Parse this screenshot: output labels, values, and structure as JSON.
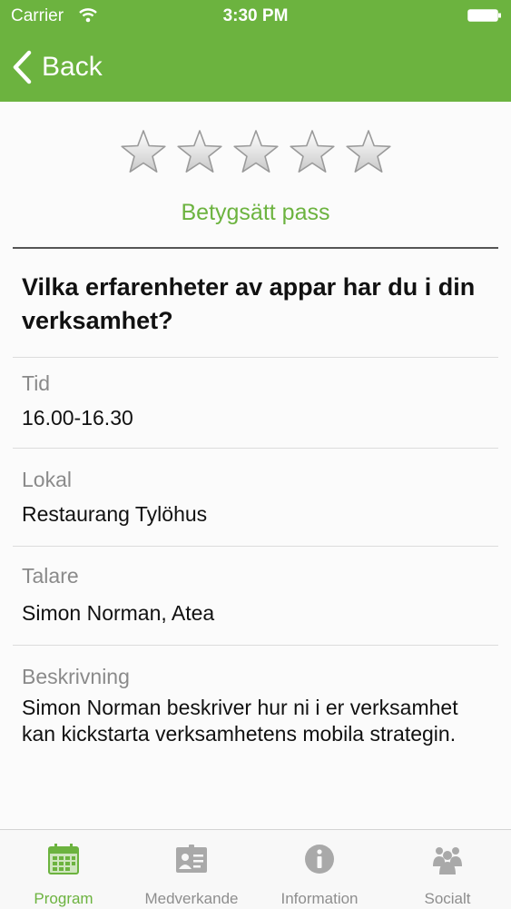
{
  "status_bar": {
    "carrier": "Carrier",
    "time": "3:30 PM"
  },
  "nav": {
    "back_label": "Back"
  },
  "rating": {
    "star_count": 5,
    "label": "Betygsätt pass"
  },
  "session": {
    "title": "Vilka erfarenheter av appar har du i din verksamhet?",
    "fields": [
      {
        "label": "Tid",
        "value": "16.00-16.30"
      },
      {
        "label": "Lokal",
        "value": "Restaurang Tylöhus"
      },
      {
        "label": "Talare",
        "value": "Simon Norman, Atea"
      },
      {
        "label": "Beskrivning",
        "value": "Simon Norman beskriver hur ni i er verksamhet kan kickstarta verksamhetens mobila strategin."
      }
    ]
  },
  "tabs": [
    {
      "label": "Program",
      "icon": "calendar-icon",
      "active": true
    },
    {
      "label": "Medverkande",
      "icon": "id-card-icon",
      "active": false
    },
    {
      "label": "Information",
      "icon": "info-icon",
      "active": false
    },
    {
      "label": "Socialt",
      "icon": "people-icon",
      "active": false
    }
  ],
  "colors": {
    "accent": "#6cb33f",
    "tab_inactive": "#8e8e8e"
  }
}
